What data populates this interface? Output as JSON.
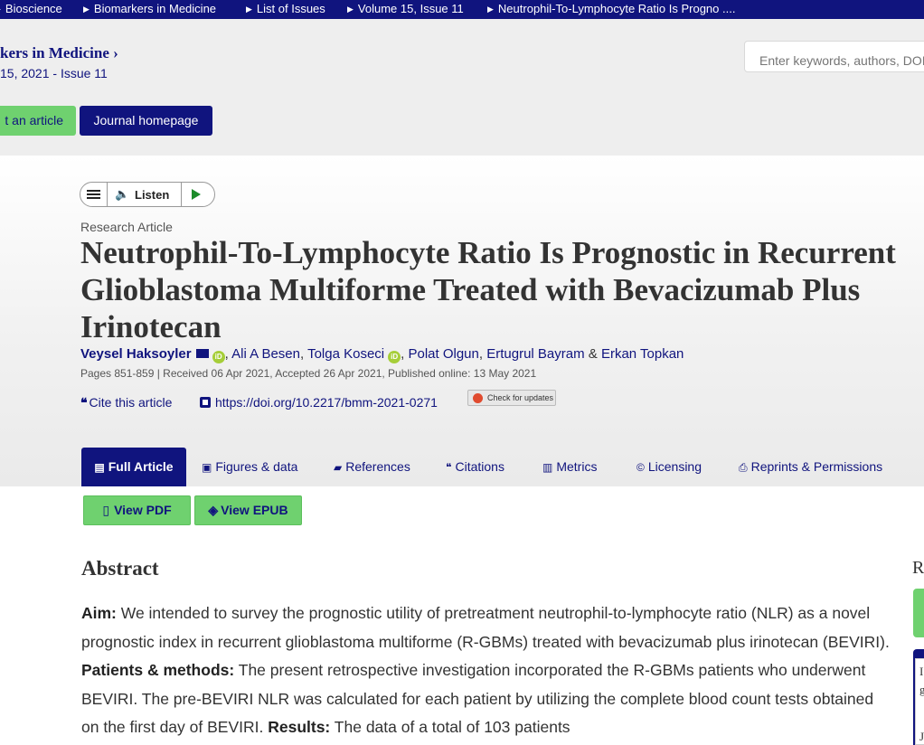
{
  "breadcrumb": {
    "items": [
      "Bioscience",
      "Biomarkers in Medicine",
      "List of Issues",
      "Volume 15, Issue 11",
      "Neutrophil-To-Lymphocyte Ratio Is Progno ...."
    ]
  },
  "journal": {
    "title": "kers in Medicine ›",
    "issue_prefix": "15, 2021 - ",
    "issue_link": "Issue 11",
    "search_placeholder": "Enter keywords, authors, DOI",
    "submit_label": "t an article",
    "homepage_label": "Journal homepage"
  },
  "listen": {
    "label": "Listen"
  },
  "article": {
    "type": "Research Article",
    "title_lines": [
      "Neutrophil-To-Lymphocyte Ratio Is Prognostic in Recurrent",
      "Glioblastoma Multiforme Treated with Bevacizumab Plus",
      "Irinotecan"
    ],
    "authors": [
      "Veysel Haksoyler",
      "Ali A Besen",
      "Tolga Koseci",
      "Polat Olgun",
      "Ertugrul Bayram",
      "Erkan Topkan"
    ],
    "author_sep": ", ",
    "author_amp": " & ",
    "pages_info": "Pages 851-859 | Received 06 Apr 2021, Accepted 26 Apr 2021, Published online: 13 May 2021",
    "cite_label": "Cite this article",
    "doi": "https://doi.org/10.2217/bmm-2021-0271",
    "updates_label": "Check for updates"
  },
  "tabs": [
    "Full Article",
    "Figures & data",
    "References",
    "Citations",
    "Metrics",
    "Licensing",
    "Reprints & Permissions"
  ],
  "downloads": {
    "pdf": "View PDF",
    "epub": "View EPUB"
  },
  "abstract": {
    "heading": "Abstract",
    "aim_label": "Aim:",
    "aim_text": " We intended to survey the prognostic utility of pretreatment neutrophil-to-lymphocyte ratio (NLR) as a novel prognostic index in recurrent glioblastoma multiforme (R-GBMs) treated with bevacizumab plus irinotecan (BEVIRI). ",
    "methods_label": "Patients & methods:",
    "methods_text": " The present retrospective investigation incorporated the R-GBMs patients who underwent BEVIRI. The pre-BEVIRI NLR was calculated for each patient by utilizing the complete blood count tests obtained on the first day of BEVIRI. ",
    "results_label": "Results:",
    "results_text": " The data of a total of 103 patients"
  },
  "sidebar": {
    "heading_partial": "R",
    "card_letters": [
      "I",
      "g",
      "J"
    ]
  },
  "colors": {
    "navy": "#10147e",
    "green": "#6fd16f",
    "orcid": "#a6ce39"
  }
}
